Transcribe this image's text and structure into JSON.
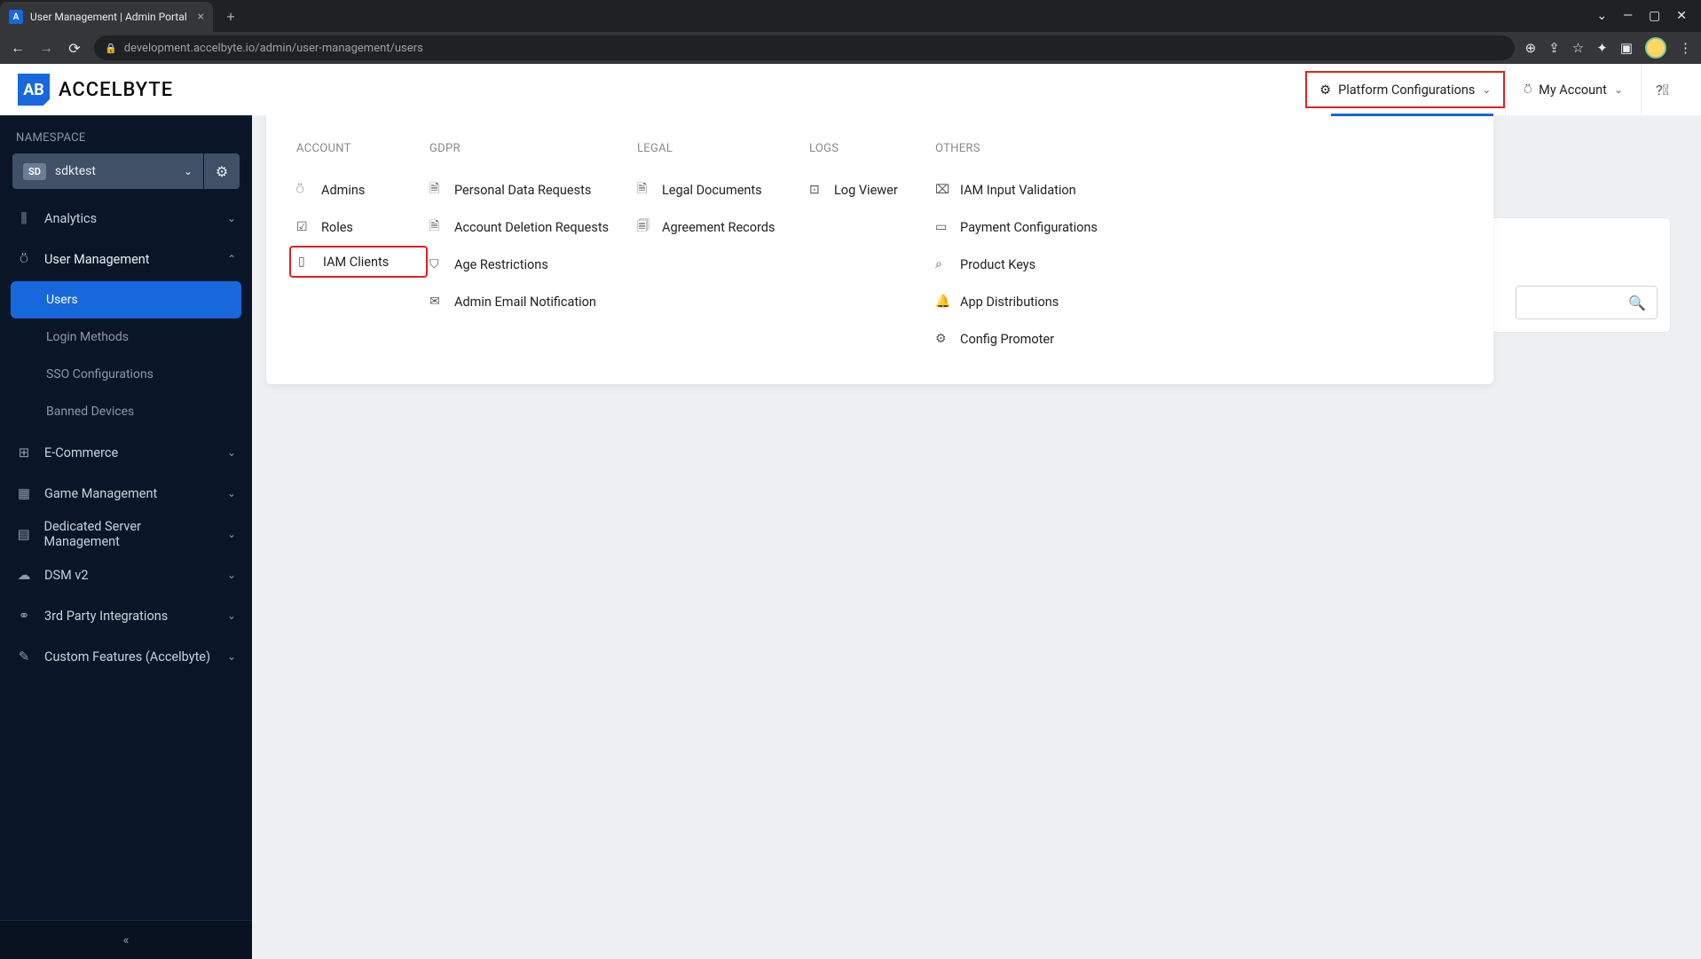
{
  "browser": {
    "tab_title": "User Management | Admin Portal",
    "url": "development.accelbyte.io/admin/user-management/users"
  },
  "brand": {
    "mark": "AB",
    "name": "ACCELBYTE"
  },
  "header": {
    "platform_config_label": "Platform Configurations",
    "my_account_label": "My Account"
  },
  "sidebar": {
    "namespace_label": "NAMESPACE",
    "namespace_badge": "SD",
    "namespace_value": "sdktest",
    "items": [
      {
        "icon": "bars",
        "label": "Analytics",
        "expanded": false
      },
      {
        "icon": "user",
        "label": "User Management",
        "expanded": true,
        "children": [
          "Users",
          "Login Methods",
          "SSO Configurations",
          "Banned Devices"
        ],
        "active_child": 0
      },
      {
        "icon": "store",
        "label": "E-Commerce",
        "expanded": false
      },
      {
        "icon": "grid",
        "label": "Game Management",
        "expanded": false
      },
      {
        "icon": "server",
        "label": "Dedicated Server Management",
        "expanded": false
      },
      {
        "icon": "cloud",
        "label": "DSM v2",
        "expanded": false
      },
      {
        "icon": "nodes",
        "label": "3rd Party Integrations",
        "expanded": false
      },
      {
        "icon": "wrench",
        "label": "Custom Features (Accelbyte)",
        "expanded": false
      }
    ]
  },
  "megamenu": {
    "columns": [
      {
        "header": "ACCOUNT",
        "items": [
          {
            "icon": "user",
            "label": "Admins"
          },
          {
            "icon": "check",
            "label": "Roles"
          },
          {
            "icon": "devices",
            "label": "IAM Clients",
            "highlighted": true
          }
        ]
      },
      {
        "header": "GDPR",
        "items": [
          {
            "icon": "doc",
            "label": "Personal Data Requests"
          },
          {
            "icon": "doc",
            "label": "Account Deletion Requests"
          },
          {
            "icon": "shield",
            "label": "Age Restrictions"
          },
          {
            "icon": "mail",
            "label": "Admin Email Notification"
          }
        ]
      },
      {
        "header": "LEGAL",
        "items": [
          {
            "icon": "doc",
            "label": "Legal Documents"
          },
          {
            "icon": "doc-check",
            "label": "Agreement Records"
          }
        ]
      },
      {
        "header": "LOGS",
        "items": [
          {
            "icon": "eye",
            "label": "Log Viewer"
          }
        ]
      },
      {
        "header": "OTHERS",
        "items": [
          {
            "icon": "input",
            "label": "IAM Input Validation"
          },
          {
            "icon": "card",
            "label": "Payment Configurations"
          },
          {
            "icon": "key",
            "label": "Product Keys"
          },
          {
            "icon": "bell",
            "label": "App Distributions"
          },
          {
            "icon": "gear",
            "label": "Config Promoter"
          }
        ]
      }
    ]
  }
}
